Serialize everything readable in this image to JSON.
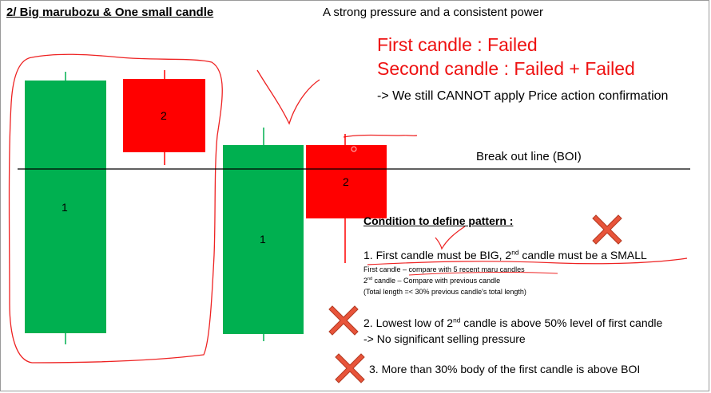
{
  "header": {
    "title": "2/ Big marubozu & One small candle",
    "subtitle": "A strong pressure and a consistent power"
  },
  "status": {
    "first": "First candle : Failed",
    "second": "Second candle : Failed + Failed",
    "note": "-> We still CANNOT apply Price action confirmation"
  },
  "boi": {
    "label": "Break out line (BOI)"
  },
  "candles": {
    "left_big": "1",
    "left_small": "2",
    "right_big": "1",
    "right_small": "2"
  },
  "conditions": {
    "title": "Condition to define pattern :",
    "c1_part1": "1. First candle must be BIG, 2",
    "c1_sup": "nd",
    "c1_part2": " candle must be a SMALL",
    "c1_sub1": "First candle – compare with  5 recent maru candles",
    "c1_sub2_sup": "nd",
    "c1_sub2_pre": "2",
    "c1_sub2_post": " candle – Compare with previous candle",
    "c1_sub3": "(Total length =< 30% previous candle's total length)",
    "c2_pre": "2. Lowest low of 2",
    "c2_sup": "nd",
    "c2_post": " candle is above 50% level of first candle",
    "c2_line2": "-> No significant selling pressure",
    "c3": "3. More than 30% body of the first  candle is above BOI"
  },
  "colors": {
    "bull": "#00b050",
    "bear": "#ff0000",
    "cross": "#e8543a",
    "pen": "#ee2222"
  }
}
